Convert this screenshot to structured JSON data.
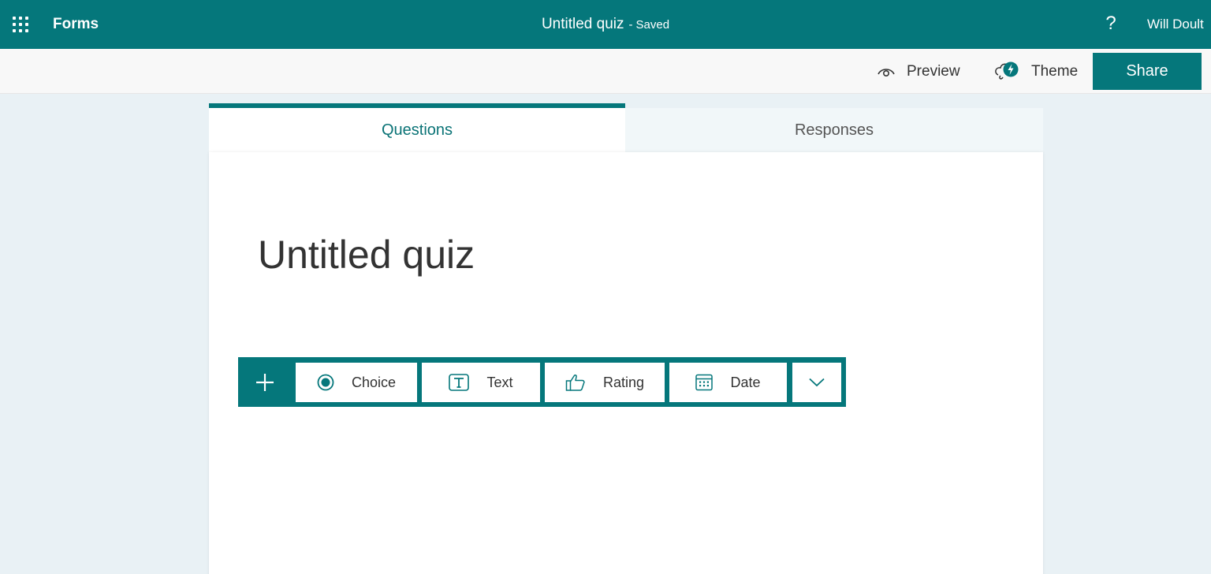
{
  "header": {
    "app_name": "Forms",
    "doc_title": "Untitled quiz",
    "separator": "-",
    "save_status": "Saved",
    "help_label": "?",
    "user_name": "Will Doult"
  },
  "commandbar": {
    "preview_label": "Preview",
    "theme_label": "Theme",
    "share_label": "Share"
  },
  "tabs": [
    {
      "label": "Questions",
      "active": true
    },
    {
      "label": "Responses",
      "active": false
    }
  ],
  "form": {
    "title": "Untitled quiz"
  },
  "add_question": {
    "types": [
      {
        "label": "Choice",
        "icon": "radio-icon"
      },
      {
        "label": "Text",
        "icon": "text-box-icon"
      },
      {
        "label": "Rating",
        "icon": "thumbs-up-icon"
      },
      {
        "label": "Date",
        "icon": "calendar-icon"
      }
    ]
  },
  "colors": {
    "brand": "#05777b",
    "tab_active_text": "#0a7376",
    "page_bg": "#e9f1f5"
  }
}
